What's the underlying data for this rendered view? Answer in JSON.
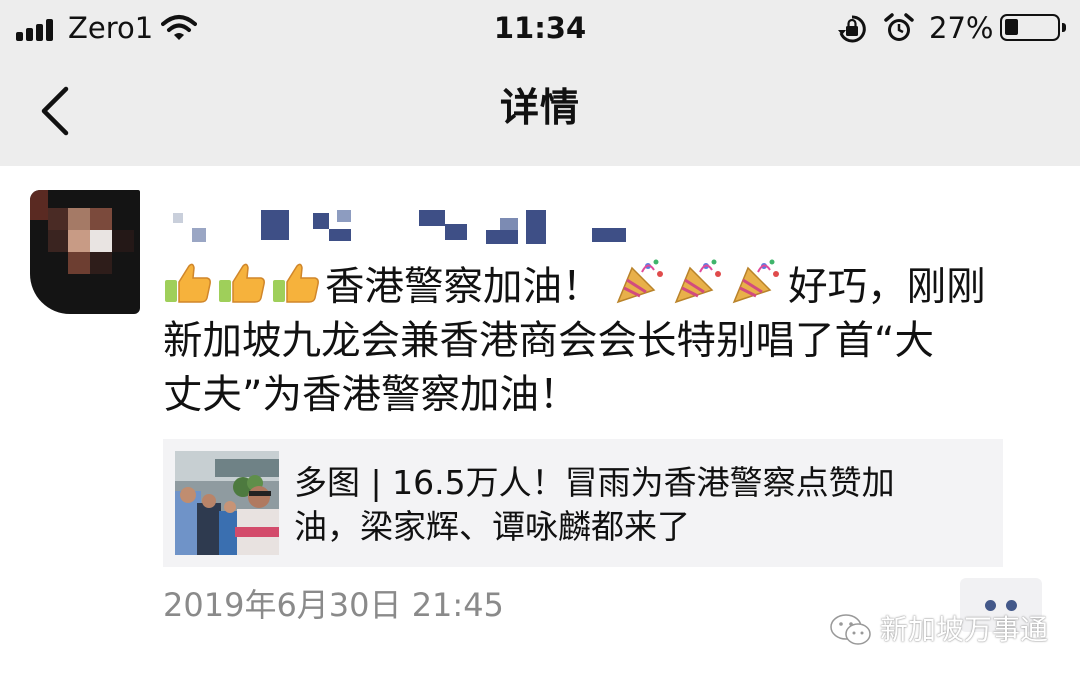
{
  "status_bar": {
    "carrier": "Zero1",
    "time": "11:34",
    "battery_percent": "27%",
    "battery_level": 0.27,
    "icons": [
      "signal-icon",
      "wifi-icon",
      "orientation-lock-icon",
      "alarm-icon",
      "battery-icon"
    ]
  },
  "nav": {
    "back_icon": "chevron-left-icon",
    "title": "详情"
  },
  "post": {
    "text": "香港警察加油！ 好巧，刚刚新加坡九龙会兼香港商会会长特别唱了首“大丈夫”为香港警察加油！",
    "emoji_before": [
      "thumbs-up",
      "thumbs-up",
      "thumbs-up"
    ],
    "emoji_middle": [
      "party-popper",
      "party-popper",
      "party-popper"
    ],
    "line_a": "香港警察加油！",
    "line_b": "好巧，刚刚",
    "line_c": "新加坡九龙会兼香港商会会长特别唱了首“大",
    "line_d": "丈夫”为香港警察加油！",
    "link_title": "多图 | 16.5万人！冒雨为香港警察点赞加油，梁家辉、谭咏麟都来了",
    "link_line1": "多图 | 16.5万人！冒雨为香港警察点赞加",
    "link_line2": "油，梁家辉、谭咏麟都来了",
    "timestamp": "2019年6月30日 21:45",
    "more_icon": "more-dots-icon"
  },
  "watermark": {
    "text": "新加坡万事通",
    "icon": "wechat-icon"
  },
  "colors": {
    "topbar_bg": "#ededed",
    "link_card_bg": "#f3f3f5",
    "timestamp": "#8a8a8a",
    "more_dots": "#44598a"
  }
}
